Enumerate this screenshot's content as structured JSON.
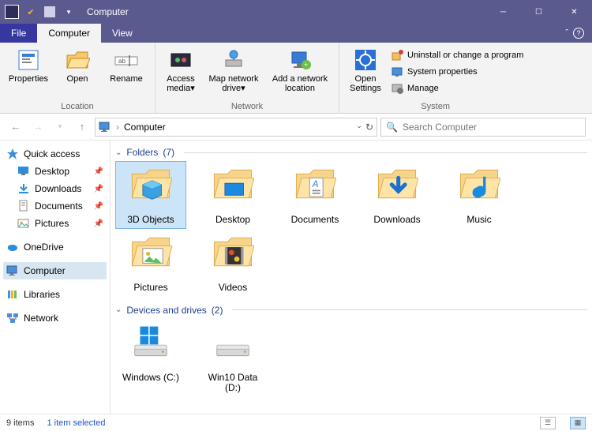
{
  "window": {
    "title": "Computer",
    "min_tooltip": "Minimize",
    "max_tooltip": "Restore Down",
    "close_tooltip": "Close"
  },
  "tabs": {
    "file": "File",
    "computer": "Computer",
    "view": "View"
  },
  "ribbon": {
    "location": {
      "label": "Location",
      "properties": "Properties",
      "open": "Open",
      "rename": "Rename"
    },
    "network": {
      "label": "Network",
      "access_media": "Access media",
      "map_drive": "Map network drive",
      "add_location": "Add a network location"
    },
    "system": {
      "label": "System",
      "open_settings": "Open Settings",
      "uninstall": "Uninstall or change a program",
      "sys_props": "System properties",
      "manage": "Manage"
    }
  },
  "nav": {
    "path_root": "Computer",
    "refresh_label": "Refresh",
    "search_placeholder": "Search Computer"
  },
  "tree": {
    "quick_access": "Quick access",
    "desktop": "Desktop",
    "downloads": "Downloads",
    "documents": "Documents",
    "pictures": "Pictures",
    "onedrive": "OneDrive",
    "computer": "Computer",
    "libraries": "Libraries",
    "network": "Network"
  },
  "sections": {
    "folders": {
      "title": "Folders",
      "count": "(7)"
    },
    "drives": {
      "title": "Devices and drives",
      "count": "(2)"
    }
  },
  "folders": [
    {
      "name": "3D Objects"
    },
    {
      "name": "Desktop"
    },
    {
      "name": "Documents"
    },
    {
      "name": "Downloads"
    },
    {
      "name": "Music"
    },
    {
      "name": "Pictures"
    },
    {
      "name": "Videos"
    }
  ],
  "drives": [
    {
      "name": "Windows (C:)"
    },
    {
      "name": "Win10 Data (D:)"
    }
  ],
  "status": {
    "count": "9 items",
    "selection": "1 item selected"
  }
}
